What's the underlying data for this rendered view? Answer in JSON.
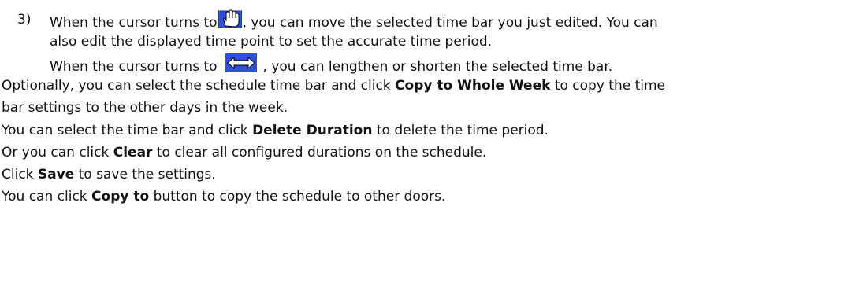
{
  "step3": {
    "number": "3)",
    "line1_before": "When the cursor turns to",
    "line1_after": ", you can move the selected time bar you just edited. You can",
    "line2": "also edit the displayed time point to set the accurate time period.",
    "line3_before": "When the cursor turns to",
    "line3_after": ", you can lengthen or shorten the selected time bar."
  },
  "icons": {
    "move": "hand-cursor-icon",
    "resize": "horizontal-resize-cursor-icon",
    "icon_bg": "#2f4fd8"
  },
  "para_copy_week": {
    "before": "Optionally, you can select the schedule time bar and click ",
    "bold": "Copy to Whole Week",
    "after": " to copy the time",
    "line2": "bar settings to the other days in the week."
  },
  "para_delete": {
    "before": "You can select the time bar and click ",
    "bold": "Delete Duration",
    "after": " to delete the time period."
  },
  "para_clear": {
    "before": "Or you can click ",
    "bold": "Clear",
    "after": " to clear all configured durations on the schedule."
  },
  "para_save": {
    "before": "Click ",
    "bold": "Save",
    "after": " to save the settings."
  },
  "para_copy_to": {
    "before": "You can click ",
    "bold": "Copy to",
    "after": " button to copy the schedule to other doors."
  }
}
